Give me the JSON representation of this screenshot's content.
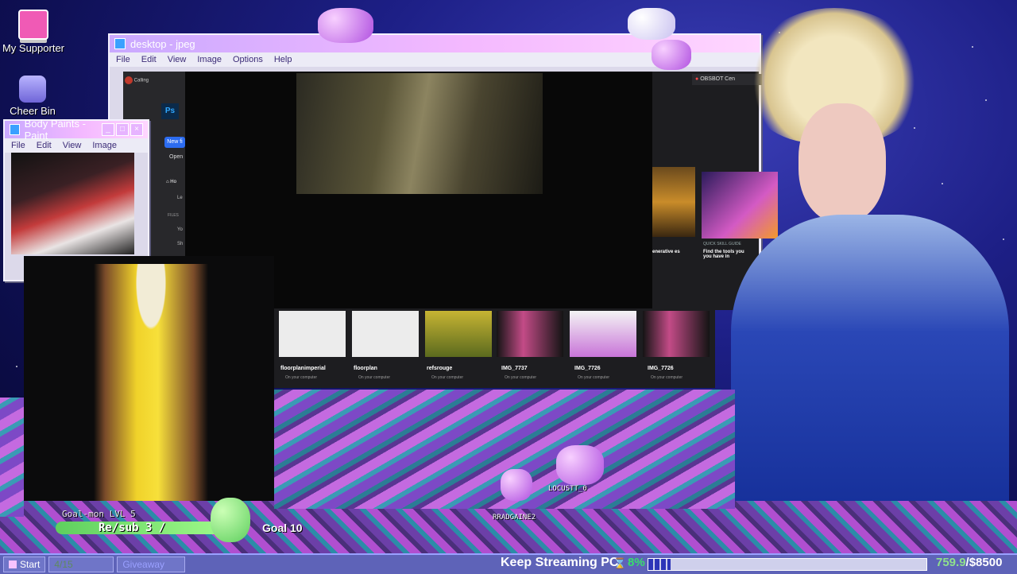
{
  "desktop": {
    "icons": [
      {
        "label": "My Supporter",
        "icon": "supporter-icon"
      },
      {
        "label": "Cheer Bin",
        "icon": "cheer-bin-icon"
      }
    ]
  },
  "main_window": {
    "title": "desktop - jpeg",
    "menu": [
      "File",
      "Edit",
      "View",
      "Image",
      "Options",
      "Help"
    ]
  },
  "paint_window": {
    "title": "Body Paints - Paint",
    "menu": [
      "File",
      "Edit",
      "View",
      "Image"
    ]
  },
  "photoshop": {
    "tab_left": "Calling",
    "tab_right": "OBSBOT Cen",
    "app_badge": "Ps",
    "new_file": "New fi",
    "open": "Open",
    "home": "Ho",
    "learn": "Le",
    "files_header": "FILES",
    "your_files": "Yo",
    "shared": "Sh",
    "card_left_caption": "enerative es",
    "card_right_label": "QUICK SKILL GUIDE",
    "card_right_text": "Find the tools you you have in",
    "recent_files": [
      {
        "name": "floorplanimperial",
        "sub": "On your computer"
      },
      {
        "name": "floorplan",
        "sub": "On your computer"
      },
      {
        "name": "refsrouge",
        "sub": "On your computer"
      },
      {
        "name": "IMG_7737",
        "sub": "On your computer"
      },
      {
        "name": "IMG_7726",
        "sub": "On your computer"
      },
      {
        "name": "IMG_7726",
        "sub": "On your computer"
      }
    ]
  },
  "goal_bar": {
    "small_label": "Goal-mon LVL 5",
    "resub": "Re/sub 3 /",
    "goal": "Goal 10"
  },
  "chat_names": [
    "LOCUSTT_0",
    "RRADGAINE2"
  ],
  "taskbar": {
    "start": "Start",
    "counter": "4/15",
    "giveaway": "Giveaway",
    "keep_streaming": "Keep Streaming PC",
    "percent": "8%",
    "amount": "759.9",
    "amount_goal": "/$8500"
  },
  "colors": {
    "taskbar": "#5e63b8",
    "titlebar_start": "#c9a9ff",
    "percent_green": "#37e06b",
    "amount_green": "#8fe08c"
  }
}
